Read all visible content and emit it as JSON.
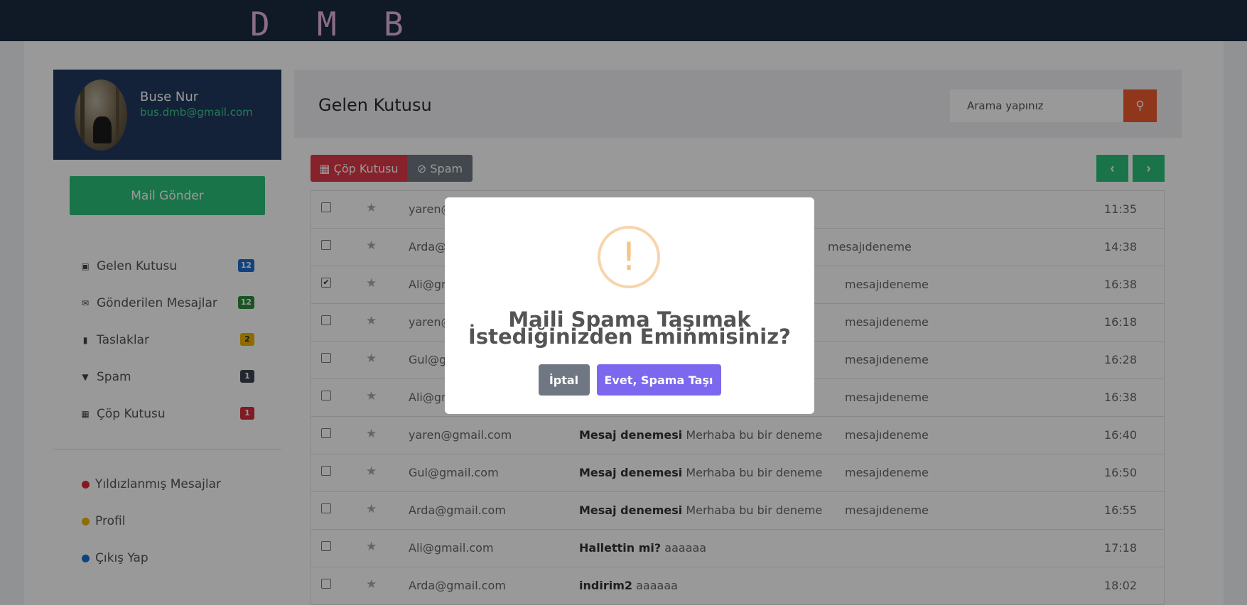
{
  "app": {
    "logo_letters": [
      "D",
      "M",
      "B"
    ]
  },
  "profile": {
    "name": "Buse Nur",
    "email": "bus.dmb@gmail.com"
  },
  "sidebar": {
    "send_button": "Mail Gönder",
    "folders": [
      {
        "label": "Gelen Kutusu",
        "count": "12",
        "icon": "inbox-icon",
        "color": "#1f6fd1"
      },
      {
        "label": "Gönderilen Mesajlar",
        "count": "12",
        "icon": "envelope-icon",
        "color": "#2e8b3c"
      },
      {
        "label": "Taslaklar",
        "count": "2",
        "icon": "file-icon",
        "color": "#f0b400"
      },
      {
        "label": "Spam",
        "count": "1",
        "icon": "filter-icon",
        "color": "#3b4450"
      },
      {
        "label": "Çöp Kutusu",
        "count": "1",
        "icon": "trash-icon",
        "color": "#d62c3c"
      }
    ],
    "labels": [
      {
        "label": "Yıldızlanmış Mesajlar",
        "color": "#e0283c"
      },
      {
        "label": "Profil",
        "color": "#f0b400"
      },
      {
        "label": "Çıkış Yap",
        "color": "#1f6fd1"
      }
    ]
  },
  "main": {
    "title": "Gelen Kutusu",
    "search_placeholder": "Arama yapınız",
    "trash_button": "Çöp Kutusu",
    "spam_button": "Spam",
    "prev_label": "‹",
    "next_label": "›"
  },
  "messages": [
    {
      "sender": "yaren@gmail.com",
      "subject": "",
      "preview": "",
      "tag": "",
      "time": "11:35",
      "checked": false
    },
    {
      "sender": "Arda@gmail.com",
      "subject": "",
      "preview": "",
      "tag": "mesajıdeneme",
      "time": "14:38",
      "checked": false
    },
    {
      "sender": "Ali@gmail.com",
      "subject": "",
      "preview": "",
      "tag": "mesajıdeneme",
      "time": "16:38",
      "checked": true
    },
    {
      "sender": "yaren@gmail.com",
      "subject": "",
      "preview": "",
      "tag": "mesajıdeneme",
      "time": "16:18",
      "checked": false
    },
    {
      "sender": "Gul@gmail.com",
      "subject": "",
      "preview": "",
      "tag": "mesajıdeneme",
      "time": "16:28",
      "checked": false
    },
    {
      "sender": "Ali@gmail.com",
      "subject": "",
      "preview": "",
      "tag": "mesajıdeneme",
      "time": "16:38",
      "checked": false
    },
    {
      "sender": "yaren@gmail.com",
      "subject": "Mesaj denemesi",
      "preview": "Merhaba bu bir deneme",
      "tag": "mesajıdeneme",
      "time": "16:40",
      "checked": false
    },
    {
      "sender": "Gul@gmail.com",
      "subject": "Mesaj denemesi",
      "preview": "Merhaba bu bir deneme",
      "tag": "mesajıdeneme",
      "time": "16:50",
      "checked": false
    },
    {
      "sender": "Arda@gmail.com",
      "subject": "Mesaj denemesi",
      "preview": "Merhaba bu bir deneme",
      "tag": "mesajıdeneme",
      "time": "16:55",
      "checked": false
    },
    {
      "sender": "Ali@gmail.com",
      "subject": "Hallettin mi?",
      "preview": "aaaaaa",
      "tag": "",
      "time": "17:18",
      "checked": false
    },
    {
      "sender": "Arda@gmail.com",
      "subject": "indirim2",
      "preview": "aaaaaa",
      "tag": "",
      "time": "18:02",
      "checked": false
    }
  ],
  "modal": {
    "icon": "warning-icon",
    "title": "Maili Spama Taşımak İstediğinizden Eminmisiniz?",
    "cancel_button": "İptal",
    "confirm_button": "Evet, Spama Taşı"
  },
  "colors": {
    "topbar": "#1b2a40",
    "profile_bg": "#203a60",
    "accent_green": "#2cc17b",
    "search_button": "#ef5b2e",
    "trash_button": "#e03a48",
    "confirm_button": "#7b68ee",
    "warning": "#f8c486"
  }
}
